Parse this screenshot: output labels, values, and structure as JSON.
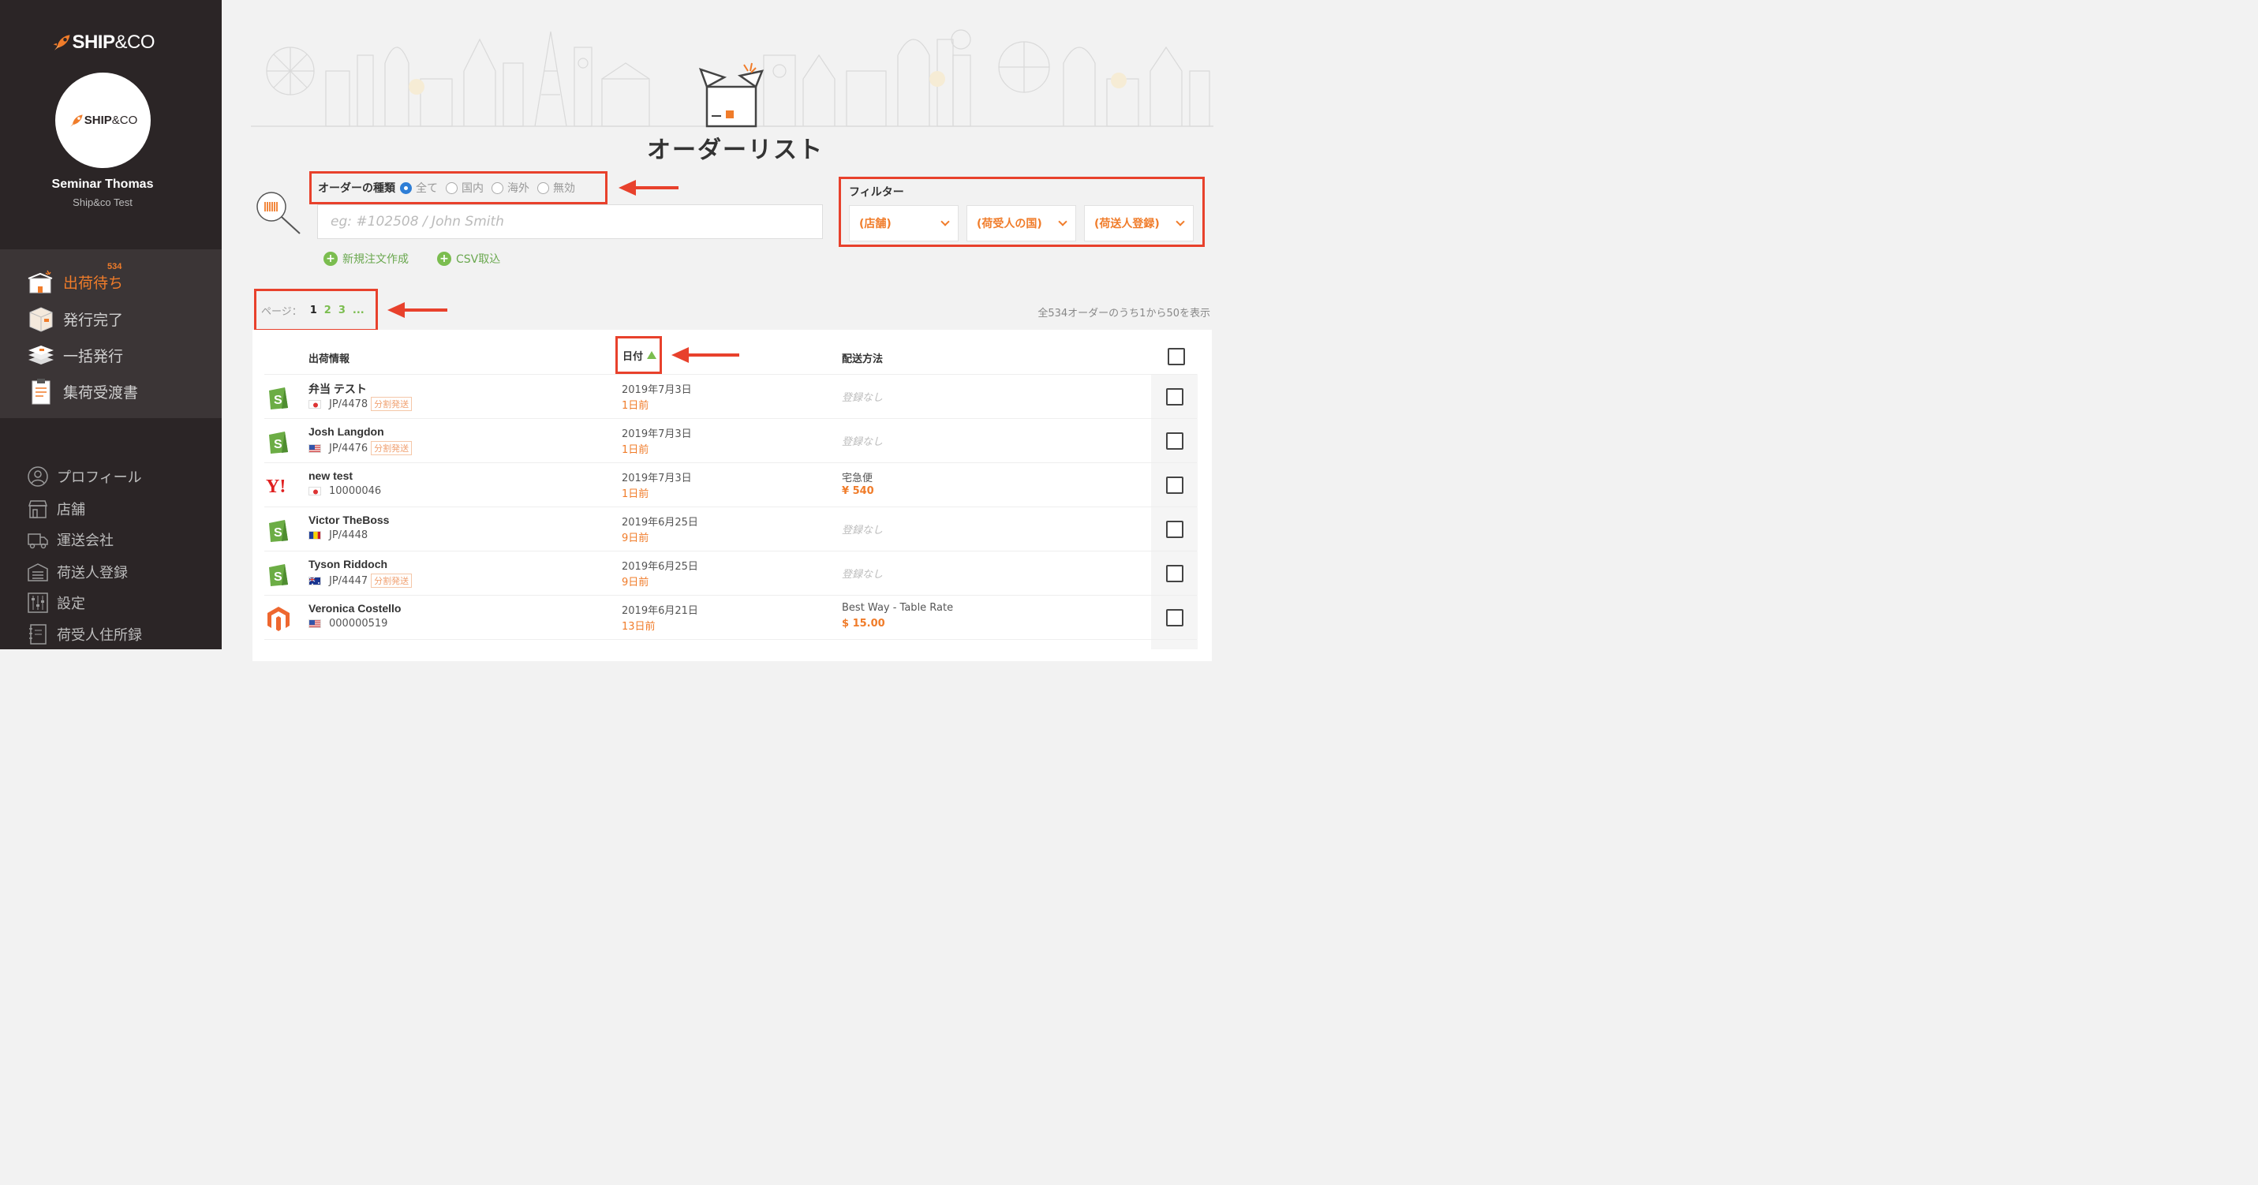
{
  "brand": {
    "name_bold": "SHIP",
    "name_thin": "&CO"
  },
  "user": {
    "name": "Seminar Thomas",
    "company": "Ship&co Test"
  },
  "nav_main": [
    {
      "label": "出荷待ち",
      "icon": "pending-box-icon",
      "badge": "534",
      "active": true
    },
    {
      "label": "発行完了",
      "icon": "completed-box-icon"
    },
    {
      "label": "一括発行",
      "icon": "bulk-stack-icon"
    },
    {
      "label": "集荷受渡書",
      "icon": "clipboard-icon"
    }
  ],
  "nav_sub": [
    {
      "label": "プロフィール",
      "icon": "profile-icon"
    },
    {
      "label": "店舗",
      "icon": "store-icon"
    },
    {
      "label": "運送会社",
      "icon": "truck-icon"
    },
    {
      "label": "荷送人登録",
      "icon": "warehouse-icon"
    },
    {
      "label": "設定",
      "icon": "settings-sliders-icon"
    },
    {
      "label": "荷受人住所録",
      "icon": "address-book-icon"
    }
  ],
  "page_title": "オーダーリスト",
  "order_type": {
    "label": "オーダーの種類",
    "options": [
      "全て",
      "国内",
      "海外",
      "無効"
    ],
    "selected": "全て"
  },
  "search": {
    "placeholder": "eg: #102508 / John Smith"
  },
  "actions": {
    "new_order": "新規注文作成",
    "csv_import": "CSV取込"
  },
  "filter": {
    "title": "フィルター",
    "dropdowns": [
      "(店舗)",
      "(荷受人の国)",
      "(荷送人登録)"
    ]
  },
  "pager": {
    "label": "ページ：",
    "pages": [
      "1",
      "2",
      "3",
      "..."
    ],
    "current": "1"
  },
  "showing": "全534オーダーのうち1から50を表示",
  "table": {
    "headers": {
      "info": "出荷情報",
      "date": "日付",
      "method": "配送方法"
    },
    "rows": [
      {
        "store": "shopify",
        "store_icon": "shopify-icon",
        "name": "弁当 テスト",
        "flag": "jp",
        "order_id": "JP/4478",
        "tag": "分割発送",
        "date": "2019年7月3日",
        "ago": "1日前",
        "method": "登録なし",
        "price": ""
      },
      {
        "store": "shopify",
        "store_icon": "shopify-icon",
        "name": "Josh Langdon",
        "flag": "us",
        "order_id": "JP/4476",
        "tag": "分割発送",
        "date": "2019年7月3日",
        "ago": "1日前",
        "method": "登録なし",
        "price": ""
      },
      {
        "store": "yahoo",
        "store_icon": "yahoo-icon",
        "name": "new test",
        "flag": "jp",
        "order_id": "10000046",
        "tag": "",
        "date": "2019年7月3日",
        "ago": "1日前",
        "method": "宅急便",
        "price": "¥ 540"
      },
      {
        "store": "shopify",
        "store_icon": "shopify-icon",
        "name": "Victor TheBoss",
        "flag": "ro",
        "order_id": "JP/4448",
        "tag": "",
        "date": "2019年6月25日",
        "ago": "9日前",
        "method": "登録なし",
        "price": ""
      },
      {
        "store": "shopify",
        "store_icon": "shopify-icon",
        "name": "Tyson Riddoch",
        "flag": "au",
        "order_id": "JP/4447",
        "tag": "分割発送",
        "date": "2019年6月25日",
        "ago": "9日前",
        "method": "登録なし",
        "price": ""
      },
      {
        "store": "magento",
        "store_icon": "magento-icon",
        "name": "Veronica Costello",
        "flag": "us",
        "order_id": "000000519",
        "tag": "",
        "date": "2019年6月21日",
        "ago": "13日前",
        "method": "Best Way - Table Rate",
        "price": "$ 15.00"
      }
    ]
  },
  "colors": {
    "accent": "#f07c2a",
    "highlight": "#e8412c",
    "green": "#7bbd4f",
    "sidebar": "#2b2526"
  }
}
